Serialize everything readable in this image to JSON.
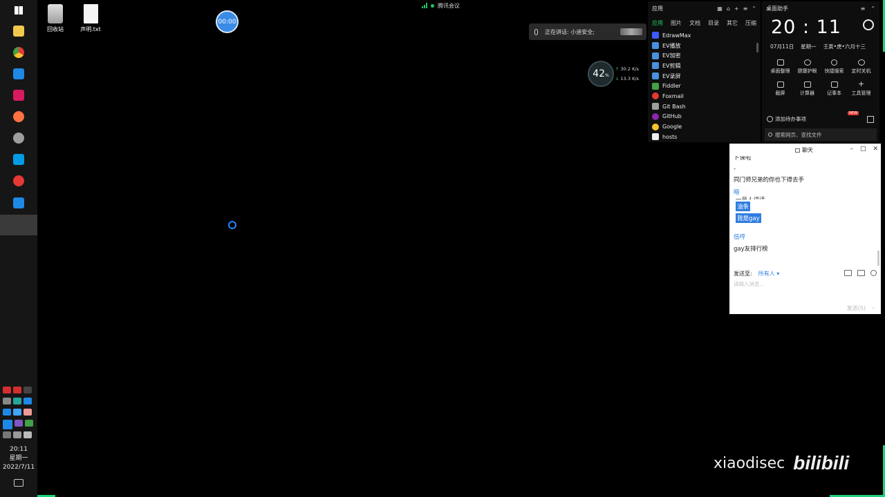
{
  "desktop": {
    "icons": [
      {
        "label": "回收站",
        "icon": "recycle-bin-icon"
      },
      {
        "label": "声明.txt",
        "icon": "text-file-icon"
      }
    ],
    "timer": "00:00"
  },
  "meeting": {
    "label": "腾讯会议"
  },
  "speaking": {
    "label": "正在讲话: 小迪安全;"
  },
  "network": {
    "percent": "42",
    "percent_unit": "%",
    "up": "30.2",
    "down": "13.3",
    "unit": "K/s"
  },
  "taskbar": {
    "apps": [
      "start-icon",
      "file-explorer-icon",
      "chrome-icon",
      "app-icon",
      "app-icon",
      "firefox-icon",
      "app-icon",
      "app-icon",
      "app-icon",
      "app-icon"
    ],
    "clock": {
      "time": "20:11",
      "weekday": "星期一",
      "date": "2022/7/11"
    }
  },
  "apps_panel": {
    "title": "应用",
    "tabs": [
      "应用",
      "图片",
      "文档",
      "目录",
      "其它",
      "压缩"
    ],
    "items": [
      "EdrawMax",
      "EV播放",
      "EV加密",
      "EV剪辑",
      "EV录屏",
      "Fiddler",
      "Foxmail",
      "Git Bash",
      "GitHub",
      "Google",
      "hosts"
    ]
  },
  "helper": {
    "title": "桌面助手",
    "time": "20 : 11",
    "date": "07月11日",
    "weekday": "星期一",
    "lunar": "壬寅•虎•六月十三",
    "tools": [
      "桌面整理",
      "健康护眼",
      "快捷搜索",
      "定时关机",
      "截屏",
      "计算器",
      "记事本",
      "工具管理"
    ],
    "todo": "添加待办事项",
    "badge": "NEW",
    "search_placeholder": "搜索网页、查找文件"
  },
  "chat": {
    "title": "聊天",
    "messages": {
      "cut_top": "卜课啦",
      "dot": "-",
      "line1": "同门师兄弟的你也下得去手",
      "sender1": "暗",
      "cut_mid": "一号人讲话",
      "hl1": "油条",
      "hl2": "我是gay",
      "sender2": "低哼",
      "line2": "gay友排行榜"
    },
    "sendto_label": "发送至:",
    "sendto_value": "所有人",
    "input_placeholder": "请输入消息...",
    "send_label": "发送(S)"
  },
  "watermark": {
    "user": "xiaodisec",
    "logo": "bilibili"
  }
}
